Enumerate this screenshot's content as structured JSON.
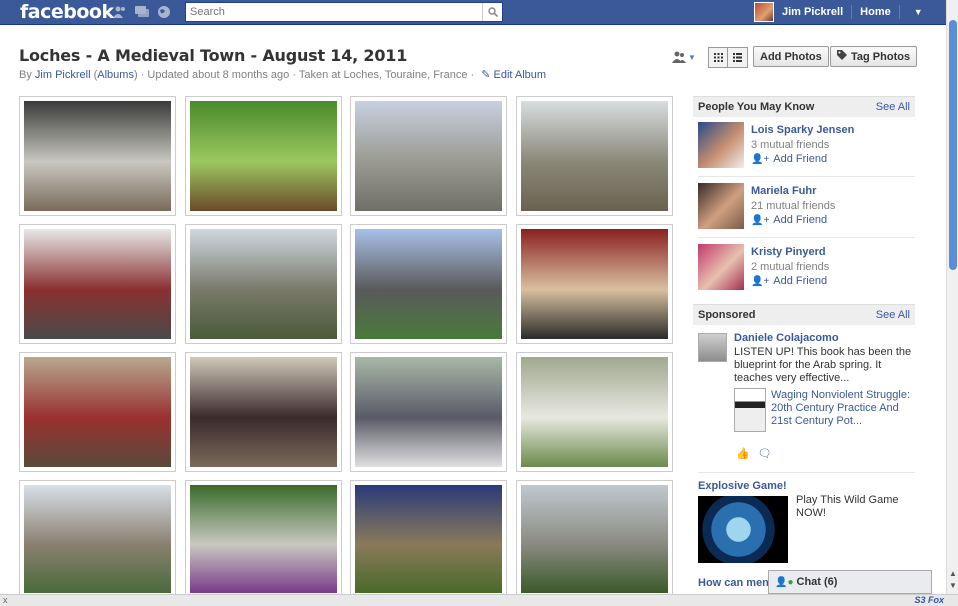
{
  "topbar": {
    "logo": "facebook",
    "search_placeholder": "Search",
    "user_name": "Jim Pickrell",
    "home_label": "Home"
  },
  "album": {
    "title": "Loches - A Medieval Town - August 14, 2011",
    "by_prefix": "By",
    "author": "Jim Pickrell",
    "albums_link": "Albums",
    "updated": "· Updated about 8 months ago · Taken at Loches, Touraine, France ·",
    "edit_album": "Edit Album"
  },
  "toolbar": {
    "add_photos": "Add Photos",
    "tag_photos": "Tag Photos"
  },
  "photos": [
    {
      "c1": "#3a3a3a",
      "c2": "#c8c8c0",
      "c3": "#7a6a5a"
    },
    {
      "c1": "#4a8a2a",
      "c2": "#9cc860",
      "c3": "#6b4a2a"
    },
    {
      "c1": "#c8d0e0",
      "c2": "#9a9a92",
      "c3": "#6f6f68"
    },
    {
      "c1": "#d8dde0",
      "c2": "#8a8878",
      "c3": "#6a6250"
    },
    {
      "c1": "#e8e8e8",
      "c2": "#8a3030",
      "c3": "#4a4a4a"
    },
    {
      "c1": "#d0d8e0",
      "c2": "#7a7a6a",
      "c3": "#4a5a3a"
    },
    {
      "c1": "#a8c0e8",
      "c2": "#5a5a5a",
      "c3": "#4a7a3a"
    },
    {
      "c1": "#8a2020",
      "c2": "#d8c0a0",
      "c3": "#2a2a2a"
    },
    {
      "c1": "#b8a890",
      "c2": "#9a3030",
      "c3": "#5a4a3a"
    },
    {
      "c1": "#d0c8b8",
      "c2": "#3a2a2a",
      "c3": "#7a6a5a"
    },
    {
      "c1": "#a8b8a8",
      "c2": "#5a5a68",
      "c3": "#e0e0e0"
    },
    {
      "c1": "#a0a890",
      "c2": "#e8e8e0",
      "c3": "#6a8a4a"
    },
    {
      "c1": "#d8e0e8",
      "c2": "#8a8070",
      "c3": "#4a6a3a"
    },
    {
      "c1": "#3a6a2a",
      "c2": "#c8c8c0",
      "c3": "#7a3a8a"
    },
    {
      "c1": "#2a3a7a",
      "c2": "#8a7a5a",
      "c3": "#4a6a2a"
    },
    {
      "c1": "#c0c8d0",
      "c2": "#8a8a80",
      "c3": "#3a5a2a"
    }
  ],
  "sidebar": {
    "pymk_title": "People You May Know",
    "see_all": "See All",
    "people": [
      {
        "name": "Lois Sparky Jensen",
        "mutual": "3 mutual friends",
        "add": "Add Friend",
        "c1": "#2a4a8a",
        "c2": "#c89070"
      },
      {
        "name": "Mariela Fuhr",
        "mutual": "21 mutual friends",
        "add": "Add Friend",
        "c1": "#3a2a2a",
        "c2": "#d0a080"
      },
      {
        "name": "Kristy Pinyerd",
        "mutual": "2 mutual friends",
        "add": "Add Friend",
        "c1": "#c03a6a",
        "c2": "#e8c0b0"
      }
    ],
    "sponsored_title": "Sponsored",
    "ad": {
      "name": "Daniele Colajacomo",
      "text": "LISTEN UP! This book has been the blueprint for the Arab spring. It teaches very effective...",
      "book_title": "Waging Nonviolent Struggle: 20th Century Practice And 21st Century Pot..."
    },
    "game": {
      "title": "Explosive Game!",
      "text": "Play This Wild Game NOW!"
    },
    "how_can": "How can men"
  },
  "chat": {
    "label": "Chat (6)"
  },
  "statusbar": {
    "left": "x",
    "right": "S3 Fox"
  }
}
